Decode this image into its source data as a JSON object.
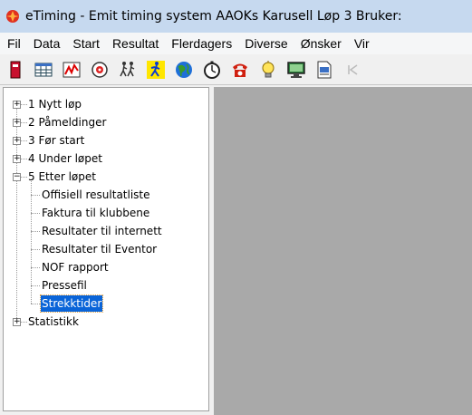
{
  "window": {
    "title": "eTiming - Emit timing system  AAOKs Karusell Løp 3   Bruker:"
  },
  "menu": [
    "Fil",
    "Data",
    "Start",
    "Resultat",
    "Flerdagers",
    "Diverse",
    "Ønsker",
    "Vir"
  ],
  "toolbar": {
    "buttons": [
      "card-icon",
      "table-icon",
      "chart-icon",
      "emit-icon",
      "runners-icon",
      "runner-icon",
      "globe-icon",
      "stopwatch-icon",
      "phone-icon",
      "bulb-icon",
      "monitor-icon",
      "document-icon",
      "first-icon"
    ]
  },
  "tree": {
    "nodes": [
      {
        "label": "1 Nytt løp",
        "expander": "+"
      },
      {
        "label": "2 Påmeldinger",
        "expander": "+"
      },
      {
        "label": "3 Før start",
        "expander": "+"
      },
      {
        "label": "4 Under løpet",
        "expander": "+"
      },
      {
        "label": "5 Etter løpet",
        "expander": "−"
      },
      {
        "label": "Offisiell resultatliste"
      },
      {
        "label": "Faktura til klubbene"
      },
      {
        "label": "Resultater til internett"
      },
      {
        "label": "Resultater til Eventor"
      },
      {
        "label": "NOF rapport"
      },
      {
        "label": "Pressefil"
      },
      {
        "label": "Strekktider",
        "selected": true
      },
      {
        "label": "Statistikk",
        "expander": "+"
      }
    ]
  }
}
